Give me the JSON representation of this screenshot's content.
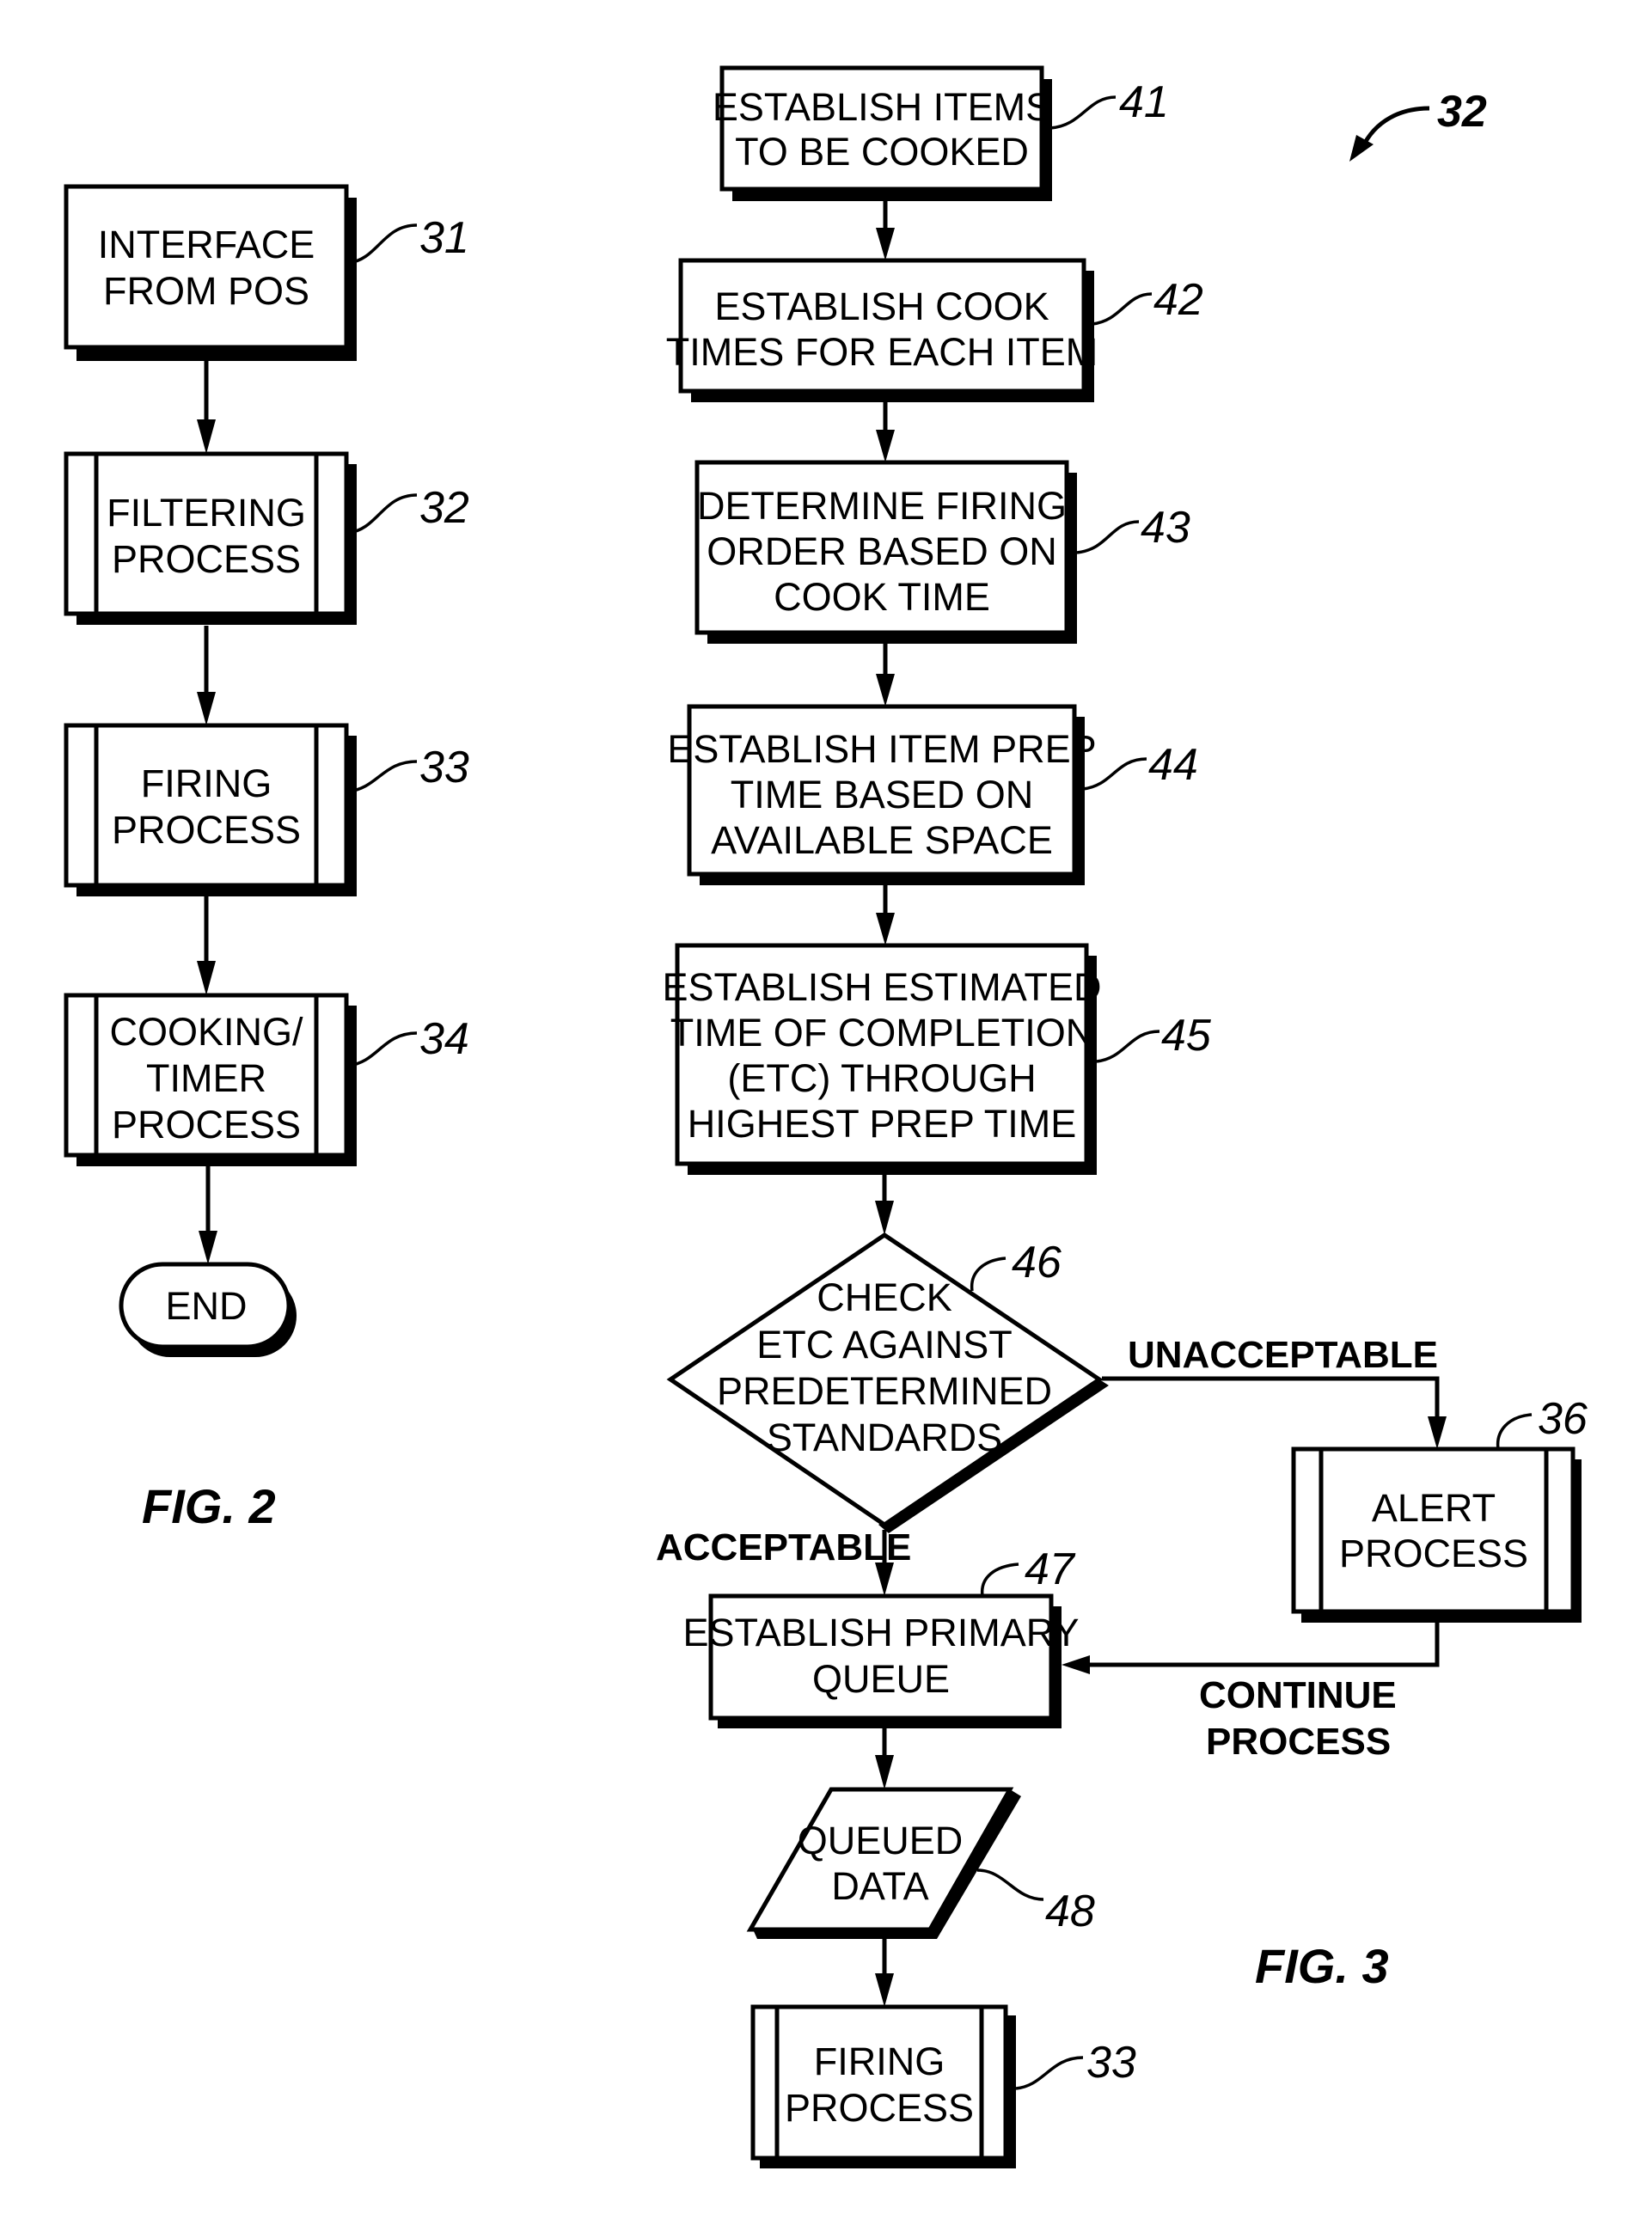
{
  "fig2": {
    "caption": "FIG. 2",
    "steps": [
      {
        "ref": "31",
        "type": "process",
        "lines": [
          "INTERFACE",
          "FROM POS"
        ]
      },
      {
        "ref": "32",
        "type": "predefined-process",
        "lines": [
          "FILTERING",
          "PROCESS"
        ]
      },
      {
        "ref": "33",
        "type": "predefined-process",
        "lines": [
          "FIRING",
          "PROCESS"
        ]
      },
      {
        "ref": "34",
        "type": "predefined-process",
        "lines": [
          "COOKING/",
          "TIMER",
          "PROCESS"
        ]
      },
      {
        "ref": "",
        "type": "terminator",
        "lines": [
          "END"
        ]
      }
    ]
  },
  "fig3": {
    "caption": "FIG. 3",
    "figure_ref": "32",
    "steps": [
      {
        "ref": "41",
        "type": "process",
        "lines": [
          "ESTABLISH ITEMS",
          "TO BE COOKED"
        ]
      },
      {
        "ref": "42",
        "type": "process",
        "lines": [
          "ESTABLISH COOK",
          "TIMES FOR EACH ITEM"
        ]
      },
      {
        "ref": "43",
        "type": "process",
        "lines": [
          "DETERMINE FIRING",
          "ORDER BASED ON",
          "COOK TIME"
        ]
      },
      {
        "ref": "44",
        "type": "process",
        "lines": [
          "ESTABLISH ITEM PREP",
          "TIME BASED ON",
          "AVAILABLE SPACE"
        ]
      },
      {
        "ref": "45",
        "type": "process",
        "lines": [
          "ESTABLISH ESTIMATED",
          "TIME OF COMPLETION",
          "(ETC) THROUGH",
          "HIGHEST PREP TIME"
        ]
      },
      {
        "ref": "46",
        "type": "decision",
        "lines": [
          "CHECK",
          "ETC AGAINST",
          "PREDETERMINED",
          "STANDARDS"
        ]
      },
      {
        "ref": "47",
        "type": "process",
        "lines": [
          "ESTABLISH PRIMARY",
          "QUEUE"
        ]
      },
      {
        "ref": "48",
        "type": "data",
        "lines": [
          "QUEUED",
          "DATA"
        ]
      },
      {
        "ref": "33",
        "type": "predefined-process",
        "lines": [
          "FIRING",
          "PROCESS"
        ]
      }
    ],
    "alert": {
      "ref": "36",
      "type": "predefined-process",
      "lines": [
        "ALERT",
        "PROCESS"
      ]
    },
    "edge_labels": {
      "acceptable": "ACCEPTABLE",
      "unacceptable": "UNACCEPTABLE",
      "continue": [
        "CONTINUE",
        "PROCESS"
      ]
    }
  }
}
